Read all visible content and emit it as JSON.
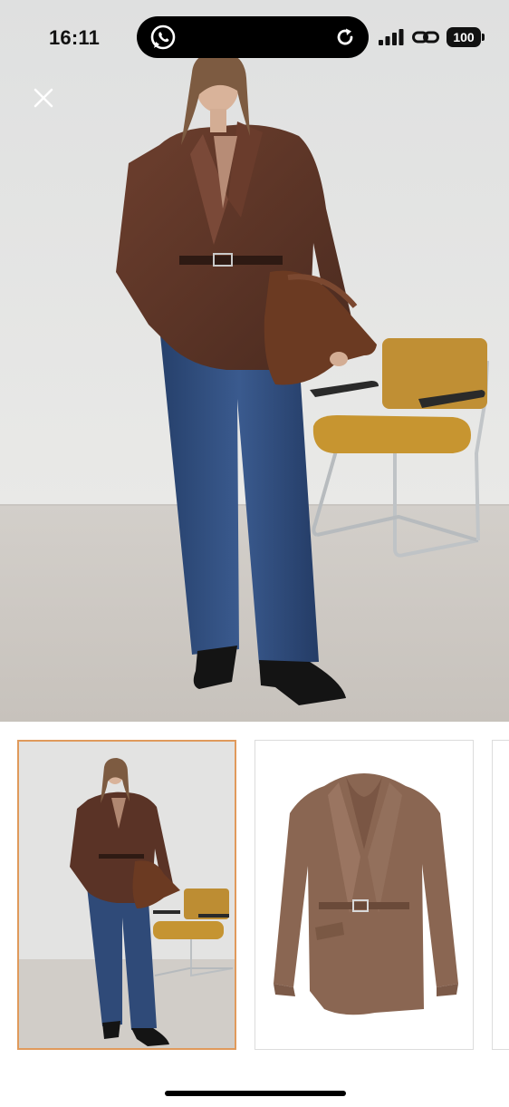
{
  "status_bar": {
    "time": "16:11",
    "battery": "100",
    "icons": [
      "whatsapp-icon",
      "refresh-icon",
      "signal-icon",
      "link-icon",
      "battery-icon"
    ]
  },
  "viewer": {
    "close_icon": "close-icon",
    "selected_thumbnail": 1,
    "thumbnails": [
      {
        "name": "thumbnail-look",
        "selected": true
      },
      {
        "name": "thumbnail-jacket",
        "selected": false
      },
      {
        "name": "thumbnail-next",
        "selected": false
      }
    ]
  },
  "colors": {
    "accent_border": "#e09a5c",
    "leather": "#5a3326",
    "denim": "#2f4a78",
    "chair_seat": "#c4912f"
  }
}
